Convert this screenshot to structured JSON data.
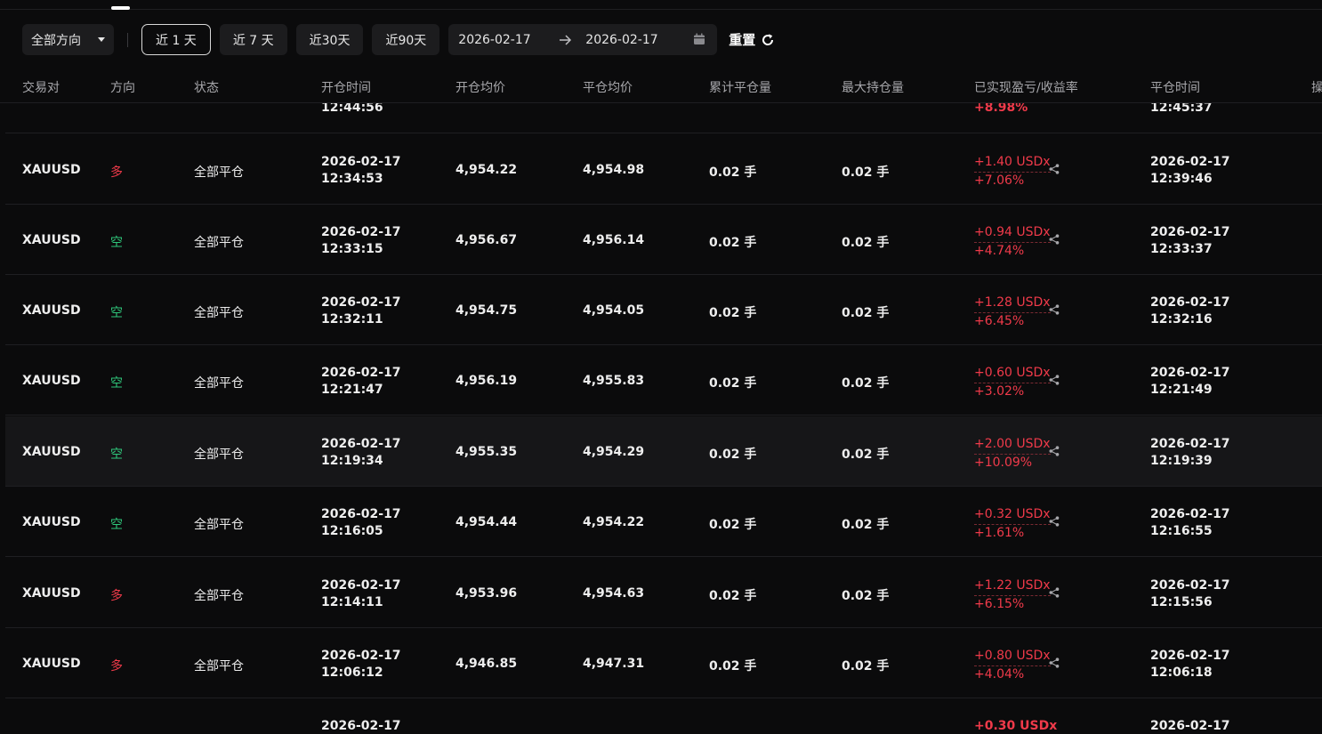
{
  "toolbar": {
    "direction_select": "全部方向",
    "ranges": [
      "近 1 天",
      "近 7 天",
      "近30天",
      "近90天"
    ],
    "active_range": "近 1 天",
    "date_start": "2026-02-17",
    "date_end": "2026-02-17",
    "reset_label": "重置"
  },
  "columns": [
    "交易对",
    "方向",
    "状态",
    "开仓时间",
    "开仓均价",
    "平仓均价",
    "累计平仓量",
    "最大持仓量",
    "已实现盈亏/收益率",
    "平仓时间",
    "操"
  ],
  "partial_top_row": {
    "open_time": "12:44:56",
    "pnl_rate": "+8.98%",
    "close_time": "12:45:37"
  },
  "rows": [
    {
      "symbol": "XAUUSD",
      "side": "多",
      "side_type": "long",
      "status": "全部平仓",
      "open_date": "2026-02-17",
      "open_time": "12:34:53",
      "open_price": "4,954.22",
      "close_price": "4,954.98",
      "cum_close": "0.02 手",
      "max_pos": "0.02 手",
      "pnl": "+1.40 USDx",
      "rate": "+7.06%",
      "close_date": "2026-02-17",
      "close_time": "12:39:46"
    },
    {
      "symbol": "XAUUSD",
      "side": "空",
      "side_type": "short",
      "status": "全部平仓",
      "open_date": "2026-02-17",
      "open_time": "12:33:15",
      "open_price": "4,956.67",
      "close_price": "4,956.14",
      "cum_close": "0.02 手",
      "max_pos": "0.02 手",
      "pnl": "+0.94 USDx",
      "rate": "+4.74%",
      "close_date": "2026-02-17",
      "close_time": "12:33:37"
    },
    {
      "symbol": "XAUUSD",
      "side": "空",
      "side_type": "short",
      "status": "全部平仓",
      "open_date": "2026-02-17",
      "open_time": "12:32:11",
      "open_price": "4,954.75",
      "close_price": "4,954.05",
      "cum_close": "0.02 手",
      "max_pos": "0.02 手",
      "pnl": "+1.28 USDx",
      "rate": "+6.45%",
      "close_date": "2026-02-17",
      "close_time": "12:32:16"
    },
    {
      "symbol": "XAUUSD",
      "side": "空",
      "side_type": "short",
      "status": "全部平仓",
      "open_date": "2026-02-17",
      "open_time": "12:21:47",
      "open_price": "4,956.19",
      "close_price": "4,955.83",
      "cum_close": "0.02 手",
      "max_pos": "0.02 手",
      "pnl": "+0.60 USDx",
      "rate": "+3.02%",
      "close_date": "2026-02-17",
      "close_time": "12:21:49"
    },
    {
      "symbol": "XAUUSD",
      "side": "空",
      "side_type": "short",
      "status": "全部平仓",
      "open_date": "2026-02-17",
      "open_time": "12:19:34",
      "open_price": "4,955.35",
      "close_price": "4,954.29",
      "cum_close": "0.02 手",
      "max_pos": "0.02 手",
      "pnl": "+2.00 USDx",
      "rate": "+10.09%",
      "close_date": "2026-02-17",
      "close_time": "12:19:39"
    },
    {
      "symbol": "XAUUSD",
      "side": "空",
      "side_type": "short",
      "status": "全部平仓",
      "open_date": "2026-02-17",
      "open_time": "12:16:05",
      "open_price": "4,954.44",
      "close_price": "4,954.22",
      "cum_close": "0.02 手",
      "max_pos": "0.02 手",
      "pnl": "+0.32 USDx",
      "rate": "+1.61%",
      "close_date": "2026-02-17",
      "close_time": "12:16:55"
    },
    {
      "symbol": "XAUUSD",
      "side": "多",
      "side_type": "long",
      "status": "全部平仓",
      "open_date": "2026-02-17",
      "open_time": "12:14:11",
      "open_price": "4,953.96",
      "close_price": "4,954.63",
      "cum_close": "0.02 手",
      "max_pos": "0.02 手",
      "pnl": "+1.22 USDx",
      "rate": "+6.15%",
      "close_date": "2026-02-17",
      "close_time": "12:15:56"
    },
    {
      "symbol": "XAUUSD",
      "side": "多",
      "side_type": "long",
      "status": "全部平仓",
      "open_date": "2026-02-17",
      "open_time": "12:06:12",
      "open_price": "4,946.85",
      "close_price": "4,947.31",
      "cum_close": "0.02 手",
      "max_pos": "0.02 手",
      "pnl": "+0.80 USDx",
      "rate": "+4.04%",
      "close_date": "2026-02-17",
      "close_time": "12:06:18"
    }
  ],
  "partial_bottom_row": {
    "open_date": "2026-02-17",
    "pnl": "+0.30 USDx",
    "close_date": "2026-02-17"
  },
  "colors": {
    "background": "#0b0b0c",
    "long": "#f03a4a",
    "short": "#2fc67a",
    "pnl_positive": "#f03a4a"
  },
  "icons": {
    "direction_caret": "caret-down-icon",
    "date_arrow": "arrow-right-icon",
    "calendar": "calendar-icon",
    "reset": "refresh-icon",
    "share": "share-icon"
  }
}
